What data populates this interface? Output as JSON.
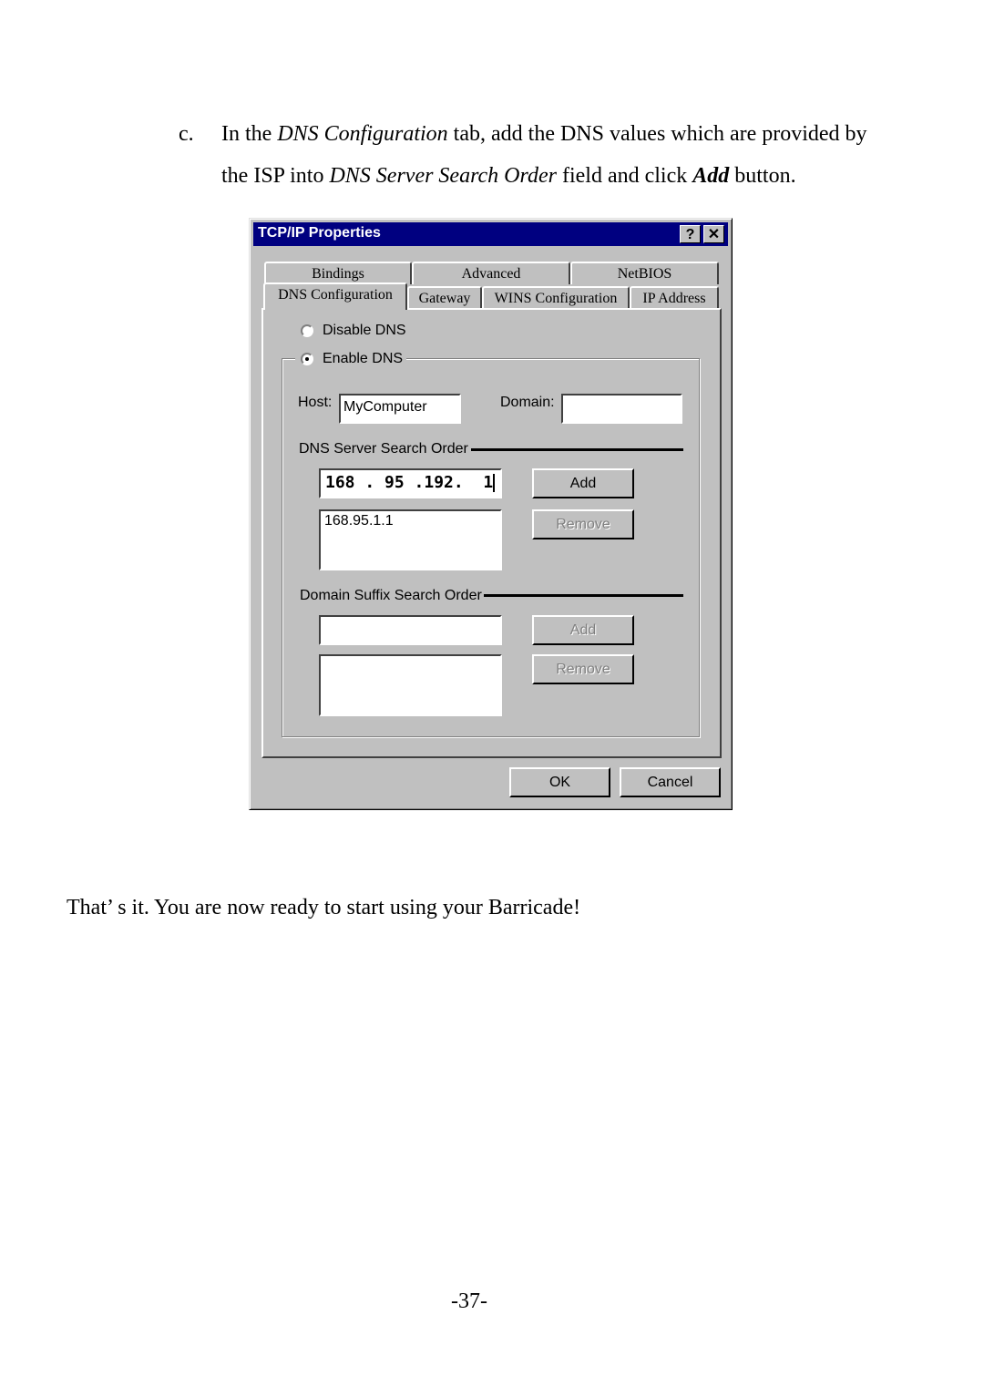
{
  "instructions": {
    "step_letter": "c.",
    "line1_prefix": "In the ",
    "line1_tab_name": "DNS Configuration",
    "line1_suffix": " tab, add the DNS values which are provided by",
    "line2_prefix": "the ISP into ",
    "line2_field_name": "DNS Server Search Order",
    "line2_middle": " field and click ",
    "line2_button_name": "Add",
    "line2_suffix": " button."
  },
  "dialog": {
    "title": "TCP/IP Properties",
    "help_glyph": "?",
    "close_glyph": "✕",
    "tabs_row1": [
      "Bindings",
      "Advanced",
      "NetBIOS"
    ],
    "tabs_row2": [
      "DNS Configuration",
      "Gateway",
      "WINS Configuration",
      "IP Address"
    ],
    "active_tab": "DNS Configuration",
    "disable_dns_label": "Disable DNS",
    "enable_dns_label": "Enable DNS",
    "selected_option": "Enable DNS",
    "host_label": "Host:",
    "host_value": "MyComputer",
    "domain_label": "Domain:",
    "domain_value": "",
    "dns_server_section": "DNS Server Search Order",
    "dns_ip_input": "168 . 95 .192.  1",
    "dns_list": [
      "168.95.1.1"
    ],
    "add_label": "Add",
    "remove_label": "Remove",
    "domain_suffix_section": "Domain Suffix Search Order",
    "suffix_input": "",
    "suffix_add_label": "Add",
    "suffix_remove_label": "Remove",
    "ok_label": "OK",
    "cancel_label": "Cancel"
  },
  "closing_text": "That’ s it.  You are now ready to start using your Barricade!",
  "page_number": "-37-"
}
